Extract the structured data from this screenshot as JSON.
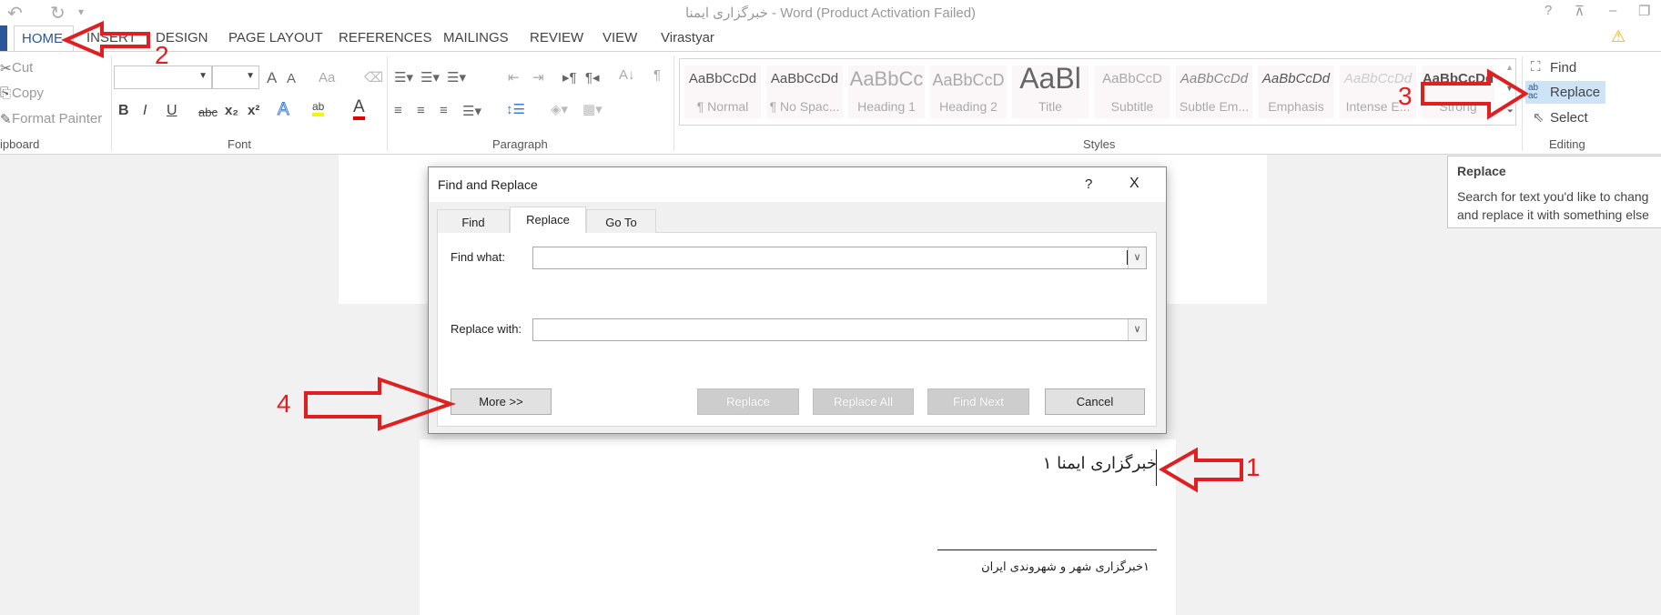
{
  "window": {
    "title": "خبرگزاری ایمنا - Word (Product Activation Failed)",
    "help": "?"
  },
  "tabs": [
    "HOME",
    "INSERT",
    "DESIGN",
    "PAGE LAYOUT",
    "REFERENCES",
    "MAILINGS",
    "REVIEW",
    "VIEW",
    "Virastyar"
  ],
  "clipboard": {
    "cut": "Cut",
    "copy": "Copy",
    "format_painter": "Format Painter",
    "label": "ipboard"
  },
  "font": {
    "label": "Font",
    "grow": "A",
    "shrink": "A",
    "case": "Aa",
    "bold": "B",
    "italic": "I",
    "underline": "U",
    "strike": "abc",
    "sub": "x₂",
    "sup": "x²",
    "text_effect": "A",
    "highlight": "ab",
    "font_color": "A",
    "highlight_color": "#f5f500",
    "font_color_value": "#e00000"
  },
  "paragraph": {
    "label": "Paragraph"
  },
  "styles": {
    "label": "Styles",
    "items": [
      {
        "sample": "AaBbCcDd",
        "name": "¶ Normal"
      },
      {
        "sample": "AaBbCcDd",
        "name": "¶ No Spac..."
      },
      {
        "sample": "AaBbCc",
        "name": "Heading 1"
      },
      {
        "sample": "AaBbCcD",
        "name": "Heading 2"
      },
      {
        "sample": "AaBl",
        "name": "Title"
      },
      {
        "sample": "AaBbCcD",
        "name": "Subtitle"
      },
      {
        "sample": "AaBbCcDd",
        "name": "Subtle Em..."
      },
      {
        "sample": "AaBbCcDd",
        "name": "Emphasis"
      },
      {
        "sample": "AaBbCcDd",
        "name": "Intense E..."
      },
      {
        "sample": "AaBbCcDd",
        "name": "Strong"
      }
    ]
  },
  "editing": {
    "label": "Editing",
    "find": "Find",
    "replace": "Replace",
    "select": "Select"
  },
  "tooltip": {
    "title": "Replace",
    "line1": "Search for text you'd like to chang",
    "line2": "and replace it with something else"
  },
  "dialog": {
    "title": "Find and Replace",
    "help": "?",
    "close": "X",
    "tabs": [
      "Find",
      "Replace",
      "Go To"
    ],
    "active_tab": "Replace",
    "find_label": "Find what:",
    "find_value": "",
    "replace_label": "Replace with:",
    "replace_value": "",
    "buttons": {
      "more": "More >>",
      "replace": "Replace",
      "replace_all": "Replace All",
      "find_next": "Find Next",
      "cancel": "Cancel"
    }
  },
  "document": {
    "heading": "خبرگزاری ایمنا ۱",
    "footnote": "۱خبرگزاری شهر و شهروندی ایران"
  },
  "annotations": {
    "n1": "1",
    "n2": "2",
    "n3": "3",
    "n4": "4",
    "color": "#e02020"
  }
}
